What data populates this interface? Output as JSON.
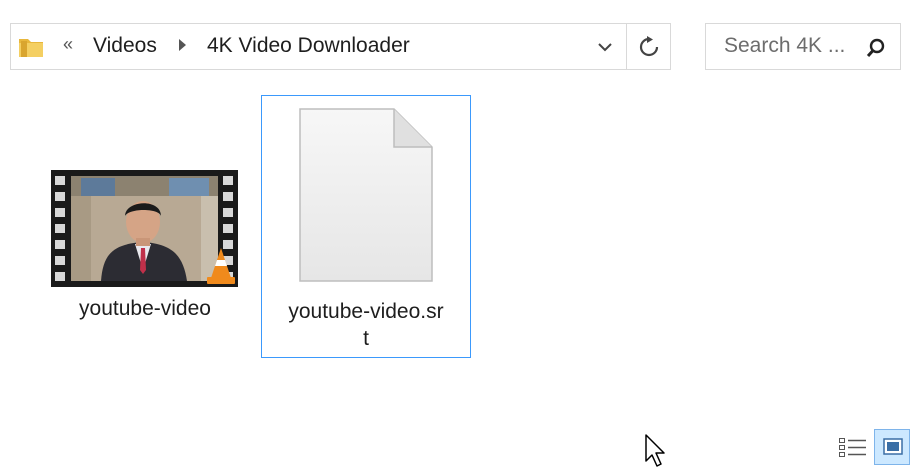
{
  "address_bar": {
    "overflow_glyph": "«",
    "crumbs": [
      "Videos",
      "4K Video Downloader"
    ]
  },
  "search": {
    "placeholder": "Search 4K ..."
  },
  "files": [
    {
      "name": "youtube-video",
      "type": "video",
      "selected": false
    },
    {
      "name_line1": "youtube-video.sr",
      "name_line2": "t",
      "type": "srt",
      "selected": true
    }
  ],
  "icons": {
    "folder": "folder-icon",
    "dropdown": "chevron-down-icon",
    "refresh": "refresh-icon",
    "search": "search-icon",
    "vlc": "vlc-cone-icon",
    "details_view": "details-view-icon",
    "large_icons_view": "large-icons-view-icon"
  },
  "colors": {
    "selection_border": "#3b99fc",
    "view_active_bg": "#cce8ff"
  }
}
